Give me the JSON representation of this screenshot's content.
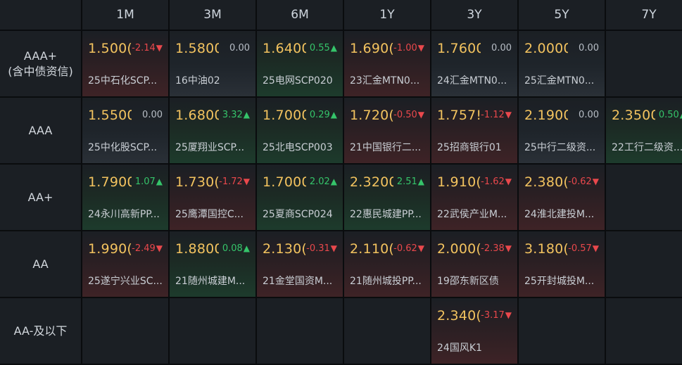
{
  "corner": "",
  "columns": [
    "1M",
    "3M",
    "6M",
    "1Y",
    "3Y",
    "5Y",
    "7Y"
  ],
  "rows": [
    {
      "label": "AAA+",
      "label2": "(含中债资信)"
    },
    {
      "label": "AAA",
      "label2": ""
    },
    {
      "label": "AA+",
      "label2": ""
    },
    {
      "label": "AA",
      "label2": ""
    },
    {
      "label": "AA-及以下",
      "label2": ""
    }
  ],
  "colors": {
    "price": "#f3c35f",
    "up": "#35c46a",
    "down": "#e9484c",
    "neutral": "#b8bec6"
  },
  "cells": [
    [
      {
        "value": "1.500(",
        "change": "-2.14",
        "dir": "down",
        "name": "25中石化SCP..."
      },
      {
        "value": "1.5800",
        "change": "0.00",
        "dir": "zero",
        "name": "16中油02"
      },
      {
        "value": "1.6400",
        "change": "0.55",
        "dir": "up",
        "name": "25电网SCP020"
      },
      {
        "value": "1.690(",
        "change": "-1.00",
        "dir": "down",
        "name": "23汇金MTN0..."
      },
      {
        "value": "1.7600",
        "change": "0.00",
        "dir": "zero",
        "name": "24汇金MTN0..."
      },
      {
        "value": "2.0000",
        "change": "0.00",
        "dir": "zero",
        "name": "25汇金MTN0..."
      },
      null
    ],
    [
      {
        "value": "1.5500",
        "change": "0.00",
        "dir": "zero",
        "name": "25中化股SCP..."
      },
      {
        "value": "1.6800",
        "change": "3.32",
        "dir": "up",
        "name": "25厦翔业SCP..."
      },
      {
        "value": "1.7000",
        "change": "0.29",
        "dir": "up",
        "name": "25北电SCP003"
      },
      {
        "value": "1.720(",
        "change": "-0.50",
        "dir": "down",
        "name": "21中国银行二..."
      },
      {
        "value": "1.757!",
        "change": "-1.12",
        "dir": "down",
        "name": "25招商银行01"
      },
      {
        "value": "2.1900",
        "change": "0.00",
        "dir": "zero",
        "name": "25中行二级资..."
      },
      {
        "value": "2.3500",
        "change": "0.50",
        "dir": "up",
        "name": "22工行二级资..."
      }
    ],
    [
      {
        "value": "1.7900",
        "change": "1.07",
        "dir": "up",
        "name": "24永川高新PP..."
      },
      {
        "value": "1.730(",
        "change": "-1.72",
        "dir": "down",
        "name": "25鹰潭国控C..."
      },
      {
        "value": "1.7000",
        "change": "2.02",
        "dir": "up",
        "name": "25夏商SCP024"
      },
      {
        "value": "2.3200",
        "change": "2.51",
        "dir": "up",
        "name": "22惠民城建PP..."
      },
      {
        "value": "1.910(",
        "change": "-1.62",
        "dir": "down",
        "name": "22武侯产业M..."
      },
      {
        "value": "2.380(",
        "change": "-0.62",
        "dir": "down",
        "name": "24淮北建投M..."
      },
      null
    ],
    [
      {
        "value": "1.990(",
        "change": "-2.49",
        "dir": "down",
        "name": "25遂宁兴业SC..."
      },
      {
        "value": "1.8800",
        "change": "0.08",
        "dir": "up",
        "name": "21随州城建M..."
      },
      {
        "value": "2.130(",
        "change": "-0.31",
        "dir": "down",
        "name": "21金堂国资M..."
      },
      {
        "value": "2.110(",
        "change": "-0.62",
        "dir": "down",
        "name": "21随州城投PP..."
      },
      {
        "value": "2.000(",
        "change": "-2.38",
        "dir": "down",
        "name": "19邵东新区债"
      },
      {
        "value": "3.180(",
        "change": "-0.57",
        "dir": "down",
        "name": "25开封城投M..."
      },
      null
    ],
    [
      null,
      null,
      null,
      null,
      {
        "value": "2.340(",
        "change": "-3.17",
        "dir": "down",
        "name": "24国风K1"
      },
      null,
      null
    ]
  ]
}
